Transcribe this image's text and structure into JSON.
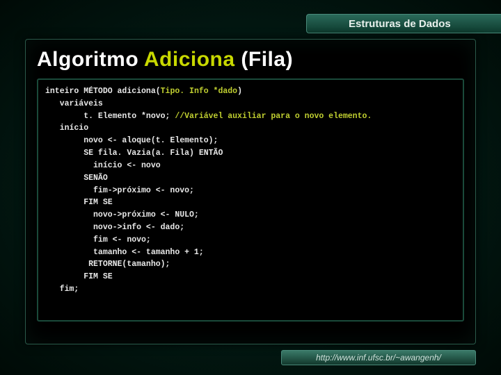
{
  "header": {
    "title": "Estruturas de Dados"
  },
  "slide": {
    "title_prefix": "Algoritmo ",
    "title_accent": "Adiciona",
    "title_suffix": " (Fila)"
  },
  "code": {
    "l1a": "inteiro MÉTODO adiciona(",
    "l1b": "Tipo. Info *dado",
    "l1c": ")",
    "l2": "   variáveis",
    "l3a": "        t. Elemento *novo; ",
    "l3b": "//Variável auxiliar para o novo elemento.",
    "l4": "   início",
    "l5": "        novo <- aloque(t. Elemento);",
    "l6": "        SE fila. Vazia(a. Fila) ENTÃO",
    "l7": "          início <- novo",
    "l8": "        SENÃO",
    "l9": "          fim->próximo <- novo;",
    "l10": "        FIM SE",
    "l11": "          novo->próximo <- NULO;",
    "l12": "          novo->info <- dado;",
    "l13": "          fim <- novo;",
    "l14": "          tamanho <- tamanho + 1;",
    "l15": "         RETORNE(tamanho);",
    "l16": "        FIM SE",
    "l17": "   fim;"
  },
  "footer": {
    "url": "http://www.inf.ufsc.br/~awangenh/"
  }
}
